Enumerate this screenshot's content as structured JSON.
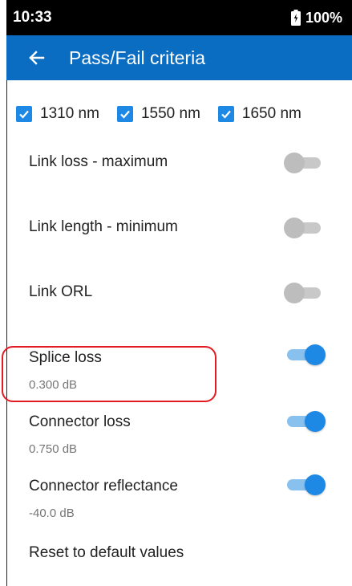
{
  "status_bar": {
    "time": "10:33",
    "battery": "100%"
  },
  "app_bar": {
    "title": "Pass/Fail criteria"
  },
  "wavelengths": [
    {
      "label": "1310 nm",
      "checked": true
    },
    {
      "label": "1550 nm",
      "checked": true
    },
    {
      "label": "1650 nm",
      "checked": true
    }
  ],
  "settings": [
    {
      "title": "Link loss - maximum",
      "value": "",
      "enabled": false
    },
    {
      "title": "Link length - minimum",
      "value": "",
      "enabled": false
    },
    {
      "title": "Link ORL",
      "value": "",
      "enabled": false
    },
    {
      "title": "Splice loss",
      "value": "0.300 dB",
      "enabled": true
    },
    {
      "title": "Connector loss",
      "value": "0.750 dB",
      "enabled": true
    },
    {
      "title": "Connector reflectance",
      "value": "-40.0 dB",
      "enabled": true
    }
  ],
  "reset_label": "Reset to default values",
  "colors": {
    "app_bar": "#0a6dc2",
    "accent": "#1e88e5",
    "highlight": "#e21a22"
  },
  "icons": [
    "battery-icon",
    "back-arrow-icon",
    "checkmark-icon"
  ]
}
